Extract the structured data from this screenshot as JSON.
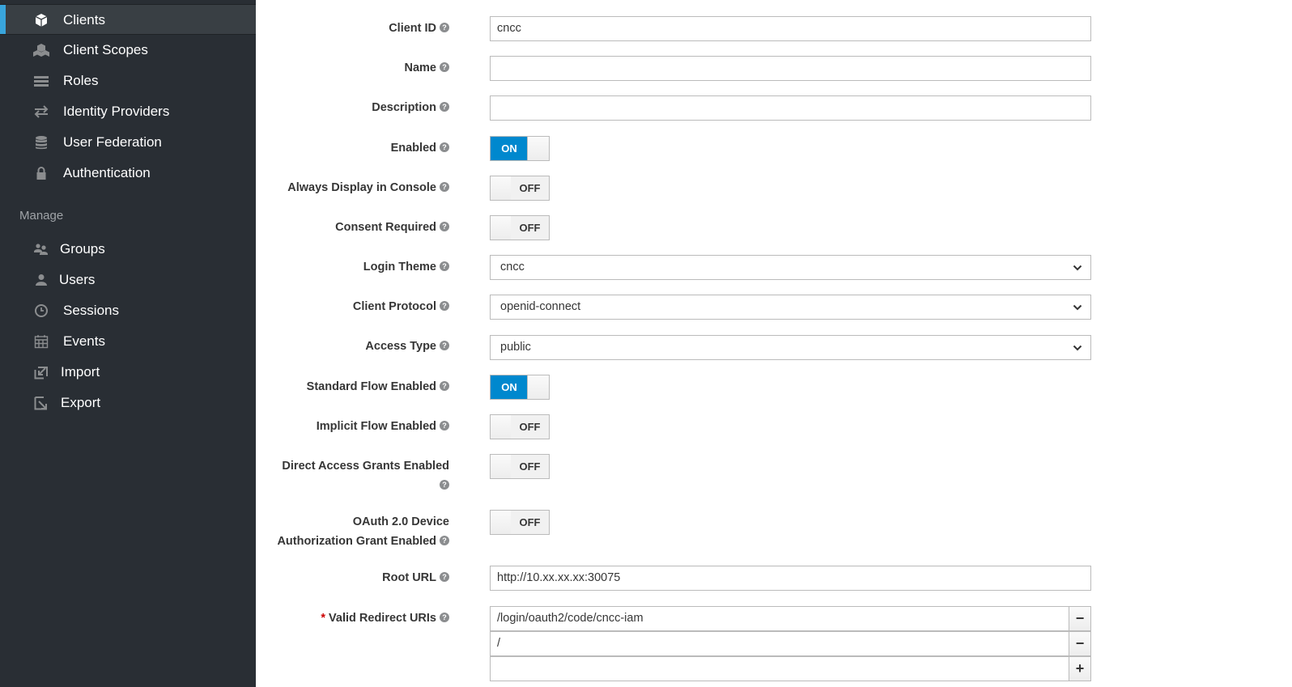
{
  "sidebar": {
    "items_top": [
      {
        "label": "Clients",
        "icon": "cube-icon",
        "active": true
      },
      {
        "label": "Client Scopes",
        "icon": "cubes-icon"
      },
      {
        "label": "Roles",
        "icon": "list-icon"
      },
      {
        "label": "Identity Providers",
        "icon": "exchange-icon"
      },
      {
        "label": "User Federation",
        "icon": "database-icon"
      },
      {
        "label": "Authentication",
        "icon": "lock-icon"
      }
    ],
    "manage_heading": "Manage",
    "items_manage": [
      {
        "label": "Groups",
        "icon": "users-icon"
      },
      {
        "label": "Users",
        "icon": "user-icon"
      },
      {
        "label": "Sessions",
        "icon": "clock-icon"
      },
      {
        "label": "Events",
        "icon": "calendar-icon"
      },
      {
        "label": "Import",
        "icon": "import-icon"
      },
      {
        "label": "Export",
        "icon": "export-icon"
      }
    ]
  },
  "form": {
    "client_id": {
      "label": "Client ID",
      "value": "cncc"
    },
    "name": {
      "label": "Name",
      "value": ""
    },
    "description": {
      "label": "Description",
      "value": ""
    },
    "enabled": {
      "label": "Enabled",
      "state": "ON"
    },
    "always_display": {
      "label": "Always Display in Console",
      "state": "OFF"
    },
    "consent_required": {
      "label": "Consent Required",
      "state": "OFF"
    },
    "login_theme": {
      "label": "Login Theme",
      "value": "cncc"
    },
    "client_protocol": {
      "label": "Client Protocol",
      "value": "openid-connect"
    },
    "access_type": {
      "label": "Access Type",
      "value": "public"
    },
    "standard_flow": {
      "label": "Standard Flow Enabled",
      "state": "ON"
    },
    "implicit_flow": {
      "label": "Implicit Flow Enabled",
      "state": "OFF"
    },
    "direct_access": {
      "label": "Direct Access Grants Enabled",
      "state": "OFF"
    },
    "oauth_device": {
      "label_line1": "OAuth 2.0 Device",
      "label_line2": "Authorization Grant Enabled",
      "state": "OFF"
    },
    "root_url": {
      "label": "Root URL",
      "value": "http://10.xx.xx.xx:30075"
    },
    "redirect_uris": {
      "label": "Valid Redirect URIs",
      "required_mark": "*",
      "values": [
        "/login/oauth2/code/cncc-iam",
        "/",
        ""
      ],
      "remove_label": "−",
      "add_label": "+"
    },
    "help_glyph": "?"
  },
  "colors": {
    "accent": "#0088ce",
    "sidebar_bg": "#292e34",
    "active_bar": "#39a5dc"
  }
}
